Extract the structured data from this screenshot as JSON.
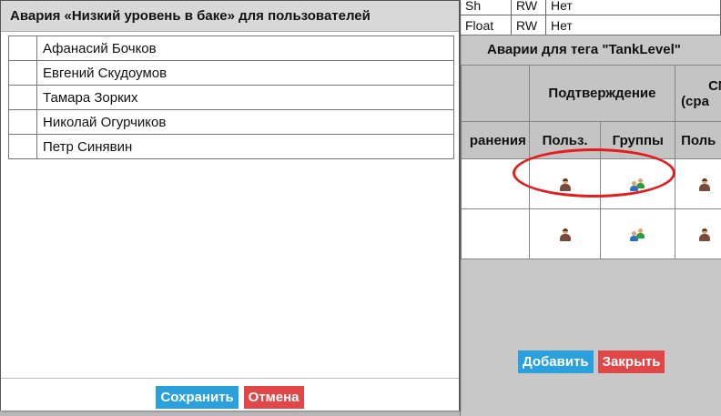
{
  "tag_table": {
    "partial_row": {
      "type": "Sh",
      "access": "RW",
      "value": "Нет"
    },
    "row": {
      "type": "Float",
      "access": "RW",
      "value": "Нет"
    }
  },
  "alarm_window": {
    "title": "Аварии для тега \"TankLevel\"",
    "headers": {
      "confirm_group": "Подтверждение",
      "right_group_line1": "СМ",
      "right_group_line2": "(сра",
      "left_cut": "ранения",
      "users": "Польз.",
      "groups": "Группы",
      "right_cut": "Поль"
    },
    "buttons": {
      "add": "Добавить",
      "close": "Закрыть"
    }
  },
  "dialog": {
    "title": "Авария «Низкий уровень в баке» для пользователей",
    "users": [
      {
        "name": "Афанасий Бочков"
      },
      {
        "name": "Евгений Скудоумов"
      },
      {
        "name": "Тамара Зоркиx"
      },
      {
        "name": "Николай Огурчиков"
      },
      {
        "name": "Петр Синявин"
      }
    ],
    "buttons": {
      "save": "Сохранить",
      "cancel": "Отмена"
    }
  },
  "icons": {
    "user": "user-icon",
    "group": "user-group-icon"
  },
  "colors": {
    "button_blue": "#2aa1dd",
    "button_red": "#e24747",
    "highlight": "#e51c1c"
  }
}
